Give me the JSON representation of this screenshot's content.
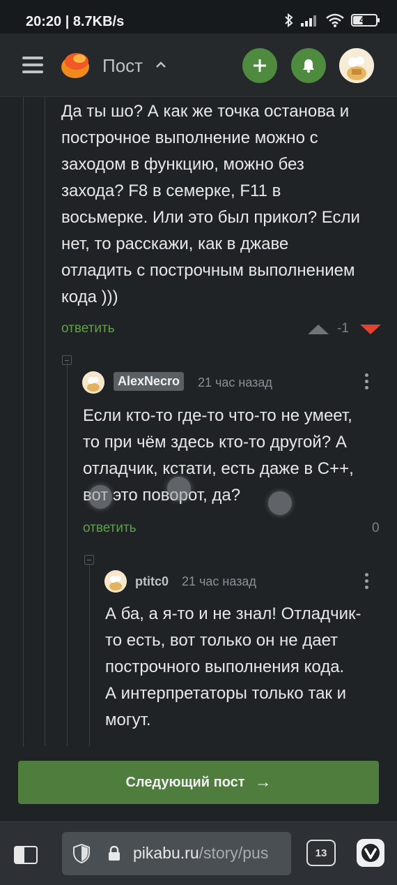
{
  "status_bar": {
    "time_speed": "20:20 | 8.7KB/s",
    "battery": "42",
    "battery_level": 0.42
  },
  "header": {
    "title": "Пост",
    "icons": [
      "hamburger-menu-icon",
      "pikabu-logo",
      "chevron-up-icon",
      "plus-icon",
      "bell-icon",
      "user-avatar"
    ],
    "accent_color": "#4e8b3f"
  },
  "comments": [
    {
      "text_lines": [
        "Да ты шо? А как же точка останова и",
        "построчное выполнение можно с",
        "заходом в функцию, можно без",
        "захода? F8 в семерке, F11 в",
        "восьмерке. Или это был прикол? Если",
        "нет, то расскажи, как в джаве",
        "отладить с построчным выполнением",
        "кода )))"
      ],
      "reply_label": "ответить",
      "rating": "-1"
    },
    {
      "author": "AlexNecro",
      "time": "21 час назад",
      "text_lines": [
        "Если кто-то где-то что-то не умеет,",
        "то при чём здесь кто-то другой? А",
        "отладчик, кстати, есть даже в C++,",
        "вот это поворот, да?"
      ],
      "reply_label": "ответить",
      "rating": "0"
    },
    {
      "author": "ptitc0",
      "time": "21 час назад",
      "text_lines": [
        "А ба, а я-то и не знал! Отладчик-",
        "то есть, вот только он не дает",
        "построчного выполнения кода.",
        "А интерпретаторы только так и",
        "могут."
      ]
    }
  ],
  "next_post": {
    "label": "Следующий пост",
    "arrow": "→"
  },
  "browser": {
    "url_host": "pikabu.ru",
    "url_path": "/story/pus",
    "tabs_count": "13"
  }
}
